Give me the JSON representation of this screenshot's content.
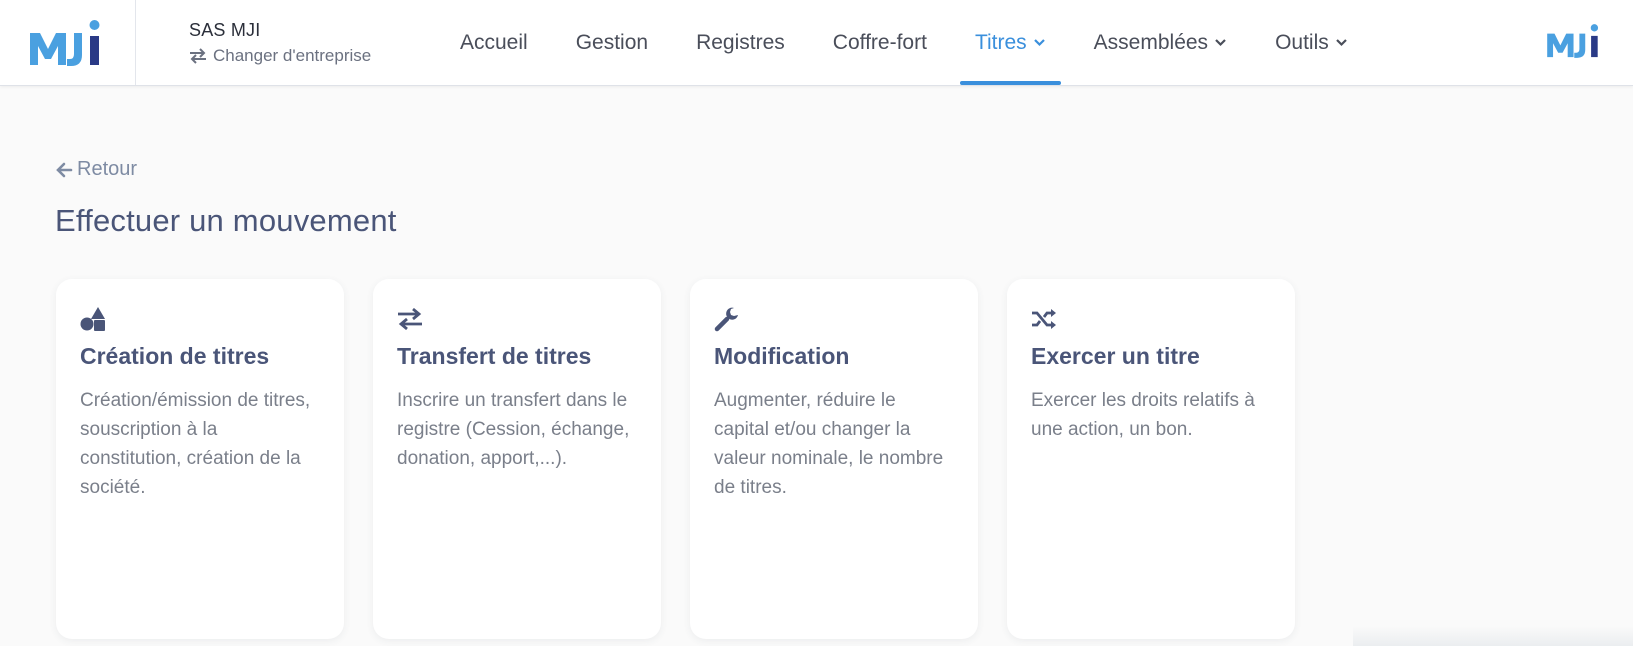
{
  "header": {
    "company_name": "SAS MJI",
    "change_company_label": "Changer d'entreprise",
    "nav": [
      {
        "label": "Accueil"
      },
      {
        "label": "Gestion"
      },
      {
        "label": "Registres"
      },
      {
        "label": "Coffre-fort"
      },
      {
        "label": "Titres",
        "active": true,
        "has_dropdown": true
      },
      {
        "label": "Assemblées",
        "has_dropdown": true
      },
      {
        "label": "Outils",
        "has_dropdown": true
      }
    ]
  },
  "back_label": "Retour",
  "page_title": "Effectuer un mouvement",
  "cards": [
    {
      "icon": "shapes-icon",
      "title": "Création de titres",
      "description": "Création/émission de titres, souscription à la constitution, création de la société."
    },
    {
      "icon": "exchange-icon",
      "title": "Transfert de titres",
      "description": "Inscrire un transfert dans le registre (Cession, échange, donation, apport,...)."
    },
    {
      "icon": "wrench-icon",
      "title": "Modification",
      "description": "Augmenter, réduire le capital et/ou changer la valeur nominale, le nombre de titres."
    },
    {
      "icon": "shuffle-icon",
      "title": "Exercer un titre",
      "description": "Exercer les droits relatifs à une action, un bon."
    }
  ],
  "colors": {
    "accent": "#3a8fdc",
    "logo_light": "#4aa0e0",
    "logo_dark": "#2a3a86",
    "title": "#4a5578"
  }
}
